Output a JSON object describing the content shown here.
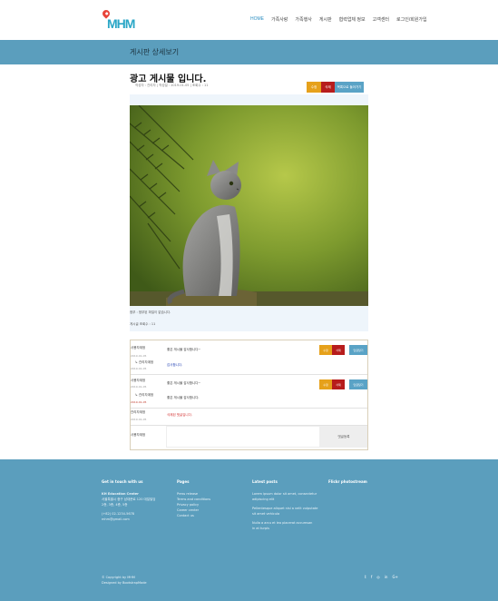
{
  "header": {
    "logo": "MHM",
    "nav": [
      "HOME",
      "가족사랑",
      "가족행사",
      "게시판",
      "협력업체 정보",
      "고객센터",
      "로그인/회원가입"
    ],
    "nav_active_index": 3
  },
  "page_title": "게시판 상세보기",
  "post": {
    "title": "광고 게시물 입니다.",
    "meta": "작성자 : 관리자 | 작성일 : 2019-01-05 | 조회수 : 11",
    "buttons": {
      "edit": "수정",
      "delete": "삭제",
      "list": "목록으로 돌아가기"
    },
    "attachment": "첨부 : 첨부된 파일이 없습니다.",
    "views": "게시글 조회수 : 11"
  },
  "comments": [
    {
      "author": "사용자계정",
      "date": "2019-01-05",
      "text": "좋은 게시물 감사합니다~",
      "has_actions": true
    },
    {
      "author": "↳ 관리자계정",
      "date": "2019-01-05",
      "text": "감사합니다.",
      "reply": true,
      "style": "blue"
    },
    {
      "author": "사용자계정",
      "date": "2019-01-05",
      "text": "좋은 게시물 감사합니다~",
      "has_actions": true
    },
    {
      "author": "↳ 관리자계정",
      "date": "2019-01-05",
      "text": "좋은 게시물 감사합니다.",
      "reply": true
    },
    {
      "author": "관리자계정",
      "date": "2019-01-05",
      "text": "삭제된 댓글입니다.",
      "style": "red"
    }
  ],
  "comment_buttons": {
    "edit": "수정",
    "delete": "삭제",
    "reply": "답글달기"
  },
  "comment_form": {
    "label": "사용자계정",
    "button": "댓글등록"
  },
  "footer": {
    "col1": {
      "heading": "Get in touch with us",
      "lines": [
        "KH Education Center",
        "서울특별시 중구 남대문로 120 대일빌딩",
        "2층, 3층, 4층, 5층",
        "",
        "(+82) 02-1234-5678",
        "mhm@gmail.com"
      ]
    },
    "col2": {
      "heading": "Pages",
      "lines": [
        "Press release",
        "Terms and conditions",
        "Privacy policy",
        "Career center",
        "Contact us"
      ]
    },
    "col3": {
      "heading": "Latest posts",
      "lines": [
        "Lorem ipsum dolor sit amet, consectetur",
        "adipiscing elit",
        "Pellentesque aliquet nisl a velit vulputate",
        "sit amet vehicula",
        "Nulla a arcu et leo placerat accumsan",
        "in at turpis"
      ]
    },
    "col4": {
      "heading": "Flickr photostream"
    },
    "copyright": [
      "© Copyright by MHM",
      "Designed by BootstrapMade"
    ],
    "social": [
      "twitter-icon",
      "facebook-icon",
      "instagram-icon",
      "linkedin-icon",
      "google-plus-icon"
    ]
  },
  "colors": {
    "band": "#5b9ebd",
    "edit": "#e6a11b",
    "delete": "#b71c1c",
    "list": "#5aa3c6"
  }
}
